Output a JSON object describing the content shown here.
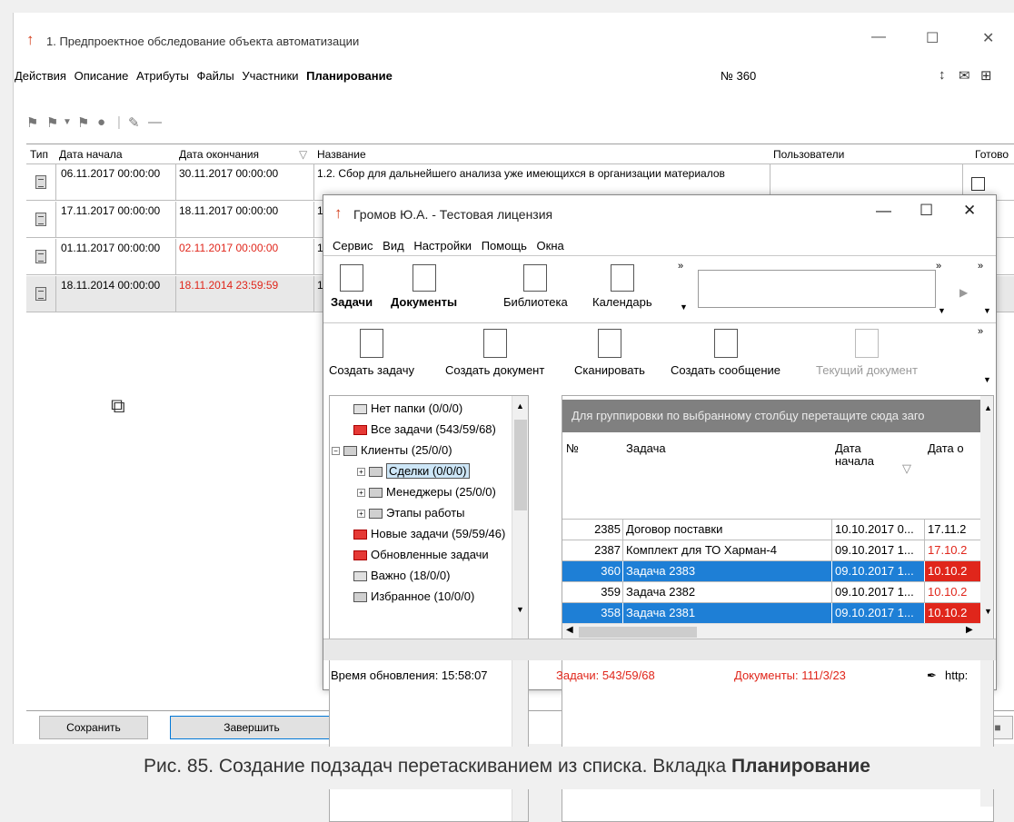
{
  "window": {
    "title": "1. Предпроектное обследование объекта автоматизации",
    "number_label": "№  360"
  },
  "menu": [
    "Действия",
    "Описание",
    "Атрибуты",
    "Файлы",
    "Участники",
    "Планирование"
  ],
  "grid": {
    "headers": [
      "Тип",
      "Дата начала",
      "Дата окончания",
      "Название",
      "Пользователи",
      "Готово"
    ],
    "rows": [
      {
        "start": "06.11.2017 00:00:00",
        "end": "30.11.2017 00:00:00",
        "name": "1.2. Сбор для дальнейшего анализа уже имеющихся в организации материалов",
        "end_red": false
      },
      {
        "start": "17.11.2017 00:00:00",
        "end": "18.11.2017 00:00:00",
        "name": "1",
        "end_red": false
      },
      {
        "start": "01.11.2017 00:00:00",
        "end": "02.11.2017 00:00:00",
        "name": "1",
        "end_red": true
      },
      {
        "start": "18.11.2014 00:00:00",
        "end": "18.11.2014 23:59:59",
        "name": "1",
        "end_red": true
      }
    ]
  },
  "buttons": {
    "save": "Сохранить",
    "finish": "Завершить"
  },
  "caption": {
    "prefix": "Рис. 85. Создание подзадач перетаскиванием из списка. Вкладка ",
    "bold": "Планирование"
  },
  "overlay": {
    "title": "Громов Ю.А. - Тестовая лицензия",
    "menu": [
      "Сервис",
      "Вид",
      "Настройки",
      "Помощь",
      "Окна"
    ],
    "nav": [
      "Задачи",
      "Документы",
      "Библиотека",
      "Календарь"
    ],
    "actions": [
      "Создать задачу",
      "Создать документ",
      "Сканировать",
      "Создать сообщение",
      "Текущий документ"
    ],
    "tree": [
      "Нет папки (0/0/0)",
      "Все задачи (543/59/68)",
      "Клиенты (25/0/0)",
      "Сделки (0/0/0)",
      "Менеджеры (25/0/0)",
      "Этапы работы",
      "Новые задачи (59/59/46)",
      "Обновленные задачи",
      "Важно (18/0/0)",
      "Избранное (10/0/0)"
    ],
    "group_hint": "Для группировки по выбранному столбцу перетащите сюда заго",
    "table_headers": {
      "num": "№",
      "task": "Задача",
      "start_1": "Дата",
      "start_2": "начала",
      "end": "Дата о"
    },
    "table_rows": [
      {
        "num": "2385",
        "task": "Договор поставки",
        "start": "10.10.2017 0...",
        "end": "17.11.2"
      },
      {
        "num": "2387",
        "task": "Комплект для ТО Харман-4",
        "start": "09.10.2017 1...",
        "end": "17.10.2"
      },
      {
        "num": "360",
        "task": "Задача 2383",
        "start": "09.10.2017 1...",
        "end": "10.10.2"
      },
      {
        "num": "359",
        "task": "Задача 2382",
        "start": "09.10.2017 1...",
        "end": "10.10.2"
      },
      {
        "num": "358",
        "task": "Задача 2381",
        "start": "09.10.2017 1...",
        "end": "10.10.2"
      }
    ],
    "status": {
      "update": "Время обновления: 15:58:07",
      "tasks": "Задачи: 543/59/68",
      "docs": "Документы: 111/3/23",
      "http": "http:"
    }
  }
}
